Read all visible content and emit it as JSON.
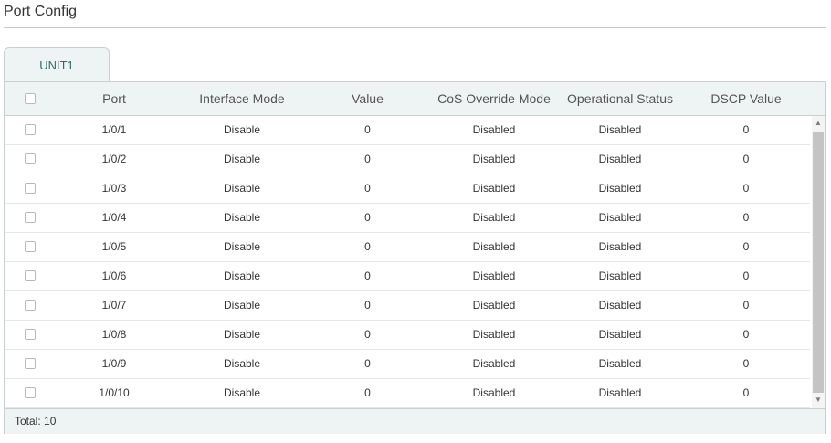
{
  "page": {
    "title": "Port Config"
  },
  "tabs": [
    {
      "label": "UNIT1",
      "active": true
    }
  ],
  "table": {
    "columns": [
      "Port",
      "Interface Mode",
      "Value",
      "CoS Override Mode",
      "Operational Status",
      "DSCP Value"
    ],
    "rows": [
      [
        "1/0/1",
        "Disable",
        "0",
        "Disabled",
        "Disabled",
        "0"
      ],
      [
        "1/0/2",
        "Disable",
        "0",
        "Disabled",
        "Disabled",
        "0"
      ],
      [
        "1/0/3",
        "Disable",
        "0",
        "Disabled",
        "Disabled",
        "0"
      ],
      [
        "1/0/4",
        "Disable",
        "0",
        "Disabled",
        "Disabled",
        "0"
      ],
      [
        "1/0/5",
        "Disable",
        "0",
        "Disabled",
        "Disabled",
        "0"
      ],
      [
        "1/0/6",
        "Disable",
        "0",
        "Disabled",
        "Disabled",
        "0"
      ],
      [
        "1/0/7",
        "Disable",
        "0",
        "Disabled",
        "Disabled",
        "0"
      ],
      [
        "1/0/8",
        "Disable",
        "0",
        "Disabled",
        "Disabled",
        "0"
      ],
      [
        "1/0/9",
        "Disable",
        "0",
        "Disabled",
        "Disabled",
        "0"
      ],
      [
        "1/0/10",
        "Disable",
        "0",
        "Disabled",
        "Disabled",
        "0"
      ]
    ]
  },
  "footer": {
    "total": "Total: 10"
  },
  "colors": {
    "accent": "#2f6f6a",
    "header_bg": "#eef3f3",
    "border": "#c8d0d0"
  }
}
